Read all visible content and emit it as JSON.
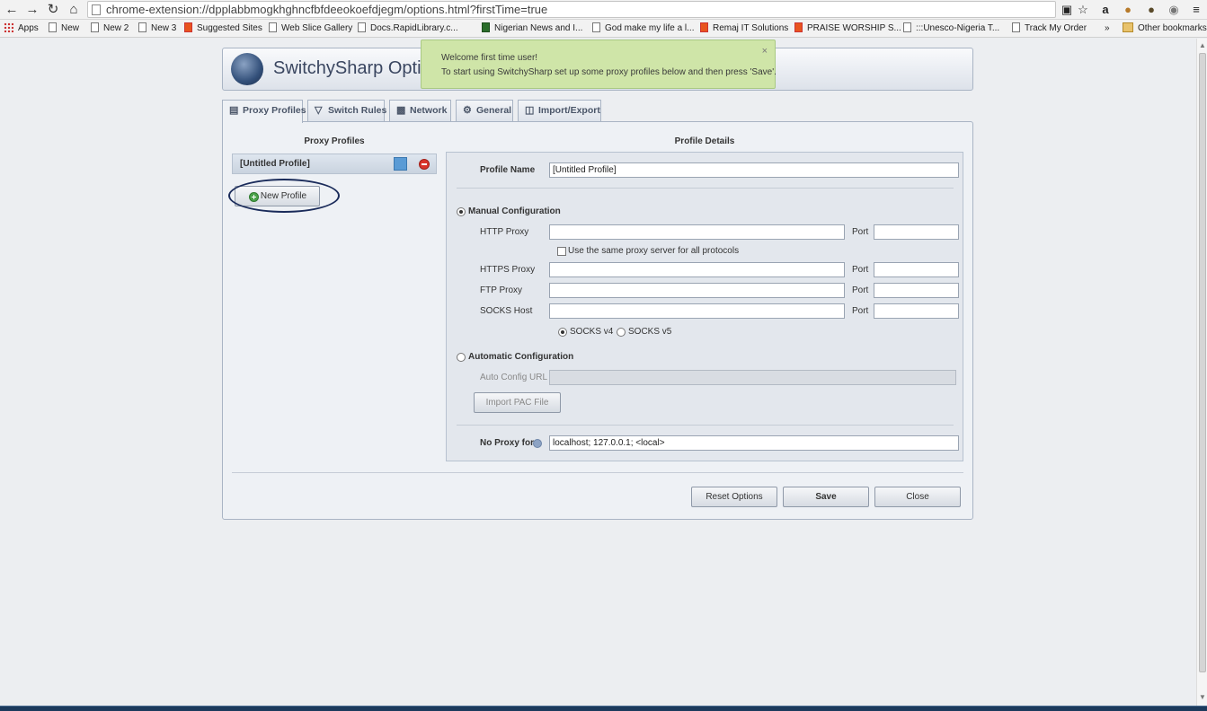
{
  "browser": {
    "url": "chrome-extension://dpplabbmogkhghncfbfdeeokoefdjegm/options.html?firstTime=true",
    "bookmarks": [
      "Apps",
      "New",
      "New 2",
      "New 3",
      "Suggested Sites",
      "Web Slice Gallery",
      "Docs.RapidLibrary.c...",
      "Nigerian News and I...",
      "God make my life a l...",
      "Remaj IT Solutions",
      "PRAISE WORSHIP S...",
      ":::Unesco-Nigeria T...",
      "Track My Order"
    ],
    "overflow": "»",
    "other_bookmarks": "Other bookmarks"
  },
  "header": {
    "title": "SwitchySharp Options"
  },
  "toast": {
    "title": "Welcome first time user!",
    "message": "To start using SwitchySharp set up some proxy profiles below and then press 'Save'.",
    "close": "×"
  },
  "tabs": [
    "Proxy Profiles",
    "Switch Rules",
    "Network",
    "General",
    "Import/Export"
  ],
  "profiles": {
    "heading": "Proxy Profiles",
    "items": [
      {
        "name": "[Untitled Profile]"
      }
    ],
    "new_button": "New Profile"
  },
  "details": {
    "heading": "Profile Details",
    "profile_name_label": "Profile Name",
    "profile_name_value": "[Untitled Profile]",
    "manual_label": "Manual Configuration",
    "http_label": "HTTP Proxy",
    "same_proxy_label": "Use the same proxy server for all protocols",
    "https_label": "HTTPS Proxy",
    "ftp_label": "FTP Proxy",
    "socks_label": "SOCKS Host",
    "port_label": "Port",
    "socks_v4": "SOCKS v4",
    "socks_v5": "SOCKS v5",
    "auto_label": "Automatic Configuration",
    "auto_url_label": "Auto Config URL",
    "import_pac": "Import PAC File",
    "no_proxy_label": "No Proxy for",
    "no_proxy_value": "localhost; 127.0.0.1; <local>"
  },
  "footer": {
    "reset": "Reset Options",
    "save": "Save",
    "close": "Close"
  }
}
